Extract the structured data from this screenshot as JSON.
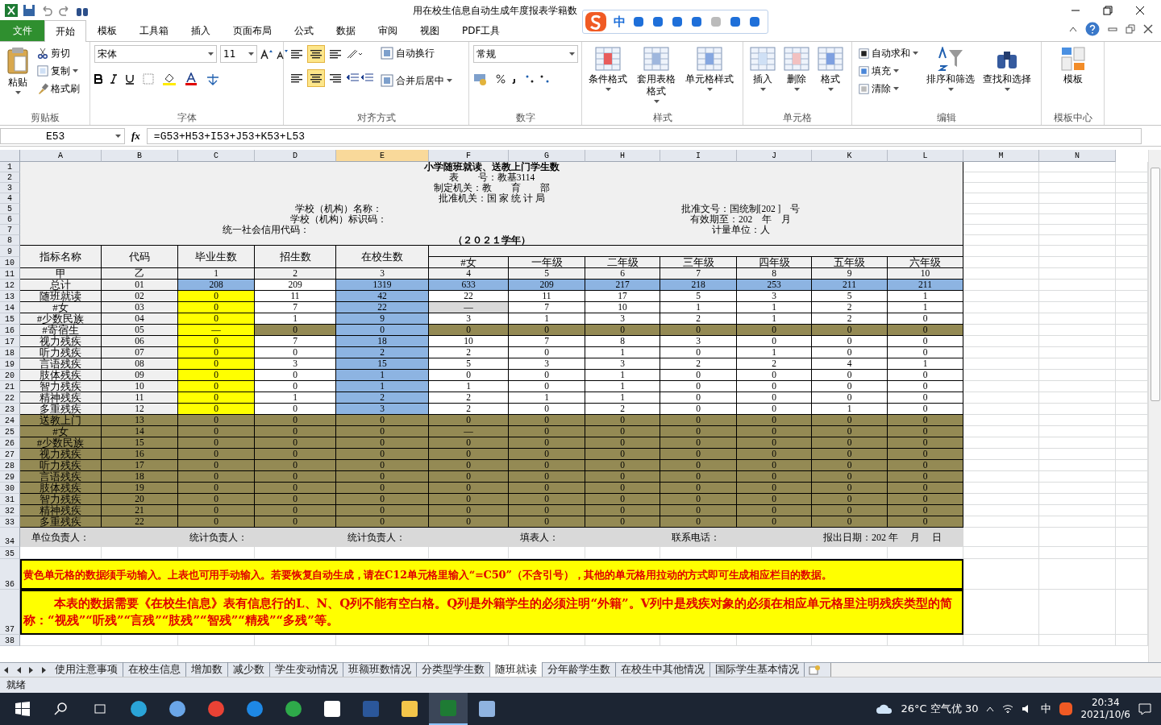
{
  "window": {
    "title": "用在校生信息自动生成年度报表学籍数"
  },
  "ime_toolbar": {
    "mode": "中"
  },
  "ribbon_tabs": [
    {
      "label": "文件",
      "kind": "file",
      "selected": false
    },
    {
      "label": "开始",
      "kind": "tab",
      "selected": true
    },
    {
      "label": "模板",
      "kind": "tab",
      "selected": false
    },
    {
      "label": "工具箱",
      "kind": "tab",
      "selected": false
    },
    {
      "label": "插入",
      "kind": "tab",
      "selected": false
    },
    {
      "label": "页面布局",
      "kind": "tab",
      "selected": false
    },
    {
      "label": "公式",
      "kind": "tab",
      "selected": false
    },
    {
      "label": "数据",
      "kind": "tab",
      "selected": false
    },
    {
      "label": "审阅",
      "kind": "tab",
      "selected": false
    },
    {
      "label": "视图",
      "kind": "tab",
      "selected": false
    },
    {
      "label": "PDF工具",
      "kind": "tab",
      "selected": false
    }
  ],
  "clipboard": {
    "paste": "粘贴",
    "cut": "剪切",
    "copy": "复制",
    "painter": "格式刷",
    "label": "剪贴板"
  },
  "font": {
    "name": "宋体",
    "size": "11",
    "label": "字体"
  },
  "alignment": {
    "vertical": [
      {
        "selected": false
      },
      {
        "selected": true
      },
      {
        "selected": false
      }
    ],
    "horizontal": [
      {
        "selected": false
      },
      {
        "selected": true
      },
      {
        "selected": false
      }
    ],
    "wrap": "自动换行",
    "merge": "合并后居中",
    "label": "对齐方式"
  },
  "number": {
    "format": "常规",
    "label": "数字"
  },
  "styles": {
    "items": [
      "条件格式",
      "套用表格格式",
      "单元格样式"
    ],
    "label": "样式"
  },
  "cells_group": {
    "items": [
      "插入",
      "删除",
      "格式"
    ],
    "label": "单元格"
  },
  "editing": {
    "small": [
      "自动求和",
      "填充",
      "清除"
    ],
    "big": [
      "排序和筛选",
      "查找和选择"
    ],
    "label": "编辑"
  },
  "template": {
    "item": "模板",
    "label": "模板中心"
  },
  "formula_bar": {
    "name_box": "E53",
    "fx_label": "fx",
    "formula": "=G53+H53+I53+J53+K53+L53"
  },
  "column_headers": [
    {
      "label": "A",
      "selected": false
    },
    {
      "label": "B",
      "selected": false
    },
    {
      "label": "C",
      "selected": false
    },
    {
      "label": "D",
      "selected": false
    },
    {
      "label": "E",
      "selected": true
    },
    {
      "label": "F",
      "selected": false
    },
    {
      "label": "G",
      "selected": false
    },
    {
      "label": "H",
      "selected": false
    },
    {
      "label": "I",
      "selected": false
    },
    {
      "label": "J",
      "selected": false
    },
    {
      "label": "K",
      "selected": false
    },
    {
      "label": "L",
      "selected": false
    },
    {
      "label": "M",
      "selected": false
    },
    {
      "label": "N",
      "selected": false
    }
  ],
  "row_numbers": [
    "1",
    "2",
    "3",
    "4",
    "5",
    "6",
    "7",
    "8",
    "9",
    "10",
    "11",
    "12",
    "13",
    "14",
    "15",
    "16",
    "17",
    "18",
    "19",
    "20",
    "21",
    "22",
    "23",
    "24",
    "25",
    "26",
    "27",
    "28",
    "29",
    "30",
    "31",
    "32",
    "33",
    "34",
    "35",
    "36",
    "37",
    "38"
  ],
  "report_header": {
    "title": "小学随班就读、送教上门学生数",
    "center_lines": [
      "表　　号：教基3114",
      "制定机关：教　　育　　部",
      "批准机关：国 家 统 计 局"
    ],
    "left_lines": [
      "学校（机构）名称：",
      "学校（机构）标识码：",
      "统一社会信用代码："
    ],
    "right_lines": [
      "批准文号：国统制[202 ]　号",
      "有效期至：202　年　月",
      "计量单位：人"
    ],
    "year": "（２０２１学年）"
  },
  "table": {
    "fixed_columns": [
      "指标名称",
      "代码",
      "毕业生数",
      "招生数",
      "在校生数"
    ],
    "grade_columns": [
      "#女",
      "一年级",
      "二年级",
      "三年级",
      "四年级",
      "五年级",
      "六年级"
    ],
    "rows": [
      {
        "cells": [
          {
            "text": "甲",
            "color": "#f0f0f0"
          },
          {
            "text": "乙",
            "color": "#f0f0f0"
          },
          {
            "text": "1",
            "color": "#f0f0f0"
          },
          {
            "text": "2",
            "color": "#f0f0f0"
          },
          {
            "text": "3",
            "color": "#f0f0f0"
          },
          {
            "text": "4",
            "color": "#f0f0f0"
          },
          {
            "text": "5",
            "color": "#f0f0f0"
          },
          {
            "text": "6",
            "color": "#f0f0f0"
          },
          {
            "text": "7",
            "color": "#f0f0f0"
          },
          {
            "text": "8",
            "color": "#f0f0f0"
          },
          {
            "text": "9",
            "color": "#f0f0f0"
          },
          {
            "text": "10",
            "color": "#f0f0f0"
          }
        ]
      },
      {
        "cells": [
          {
            "text": "总计",
            "color": "#f0f0f0"
          },
          {
            "text": "01",
            "color": "#f0f0f0"
          },
          {
            "text": "208",
            "color": "#8db4e2"
          },
          {
            "text": "209",
            "color": "#ffffff"
          },
          {
            "text": "1319",
            "color": "#8db4e2"
          },
          {
            "text": "633",
            "color": "#8db4e2"
          },
          {
            "text": "209",
            "color": "#8db4e2"
          },
          {
            "text": "217",
            "color": "#8db4e2"
          },
          {
            "text": "218",
            "color": "#8db4e2"
          },
          {
            "text": "253",
            "color": "#8db4e2"
          },
          {
            "text": "211",
            "color": "#8db4e2"
          },
          {
            "text": "211",
            "color": "#8db4e2"
          }
        ]
      },
      {
        "cells": [
          {
            "text": "随班就读",
            "color": "#f0f0f0"
          },
          {
            "text": "02",
            "color": "#f0f0f0"
          },
          {
            "text": "0",
            "color": "#ffff00"
          },
          {
            "text": "11",
            "color": "#ffffff"
          },
          {
            "text": "42",
            "color": "#8db4e2"
          },
          {
            "text": "22",
            "color": "#ffffff"
          },
          {
            "text": "11",
            "color": "#ffffff"
          },
          {
            "text": "17",
            "color": "#ffffff"
          },
          {
            "text": "5",
            "color": "#ffffff"
          },
          {
            "text": "3",
            "color": "#ffffff"
          },
          {
            "text": "5",
            "color": "#ffffff"
          },
          {
            "text": "1",
            "color": "#ffffff"
          }
        ]
      },
      {
        "cells": [
          {
            "text": "#女",
            "color": "#f0f0f0"
          },
          {
            "text": "03",
            "color": "#f0f0f0"
          },
          {
            "text": "0",
            "color": "#ffff00"
          },
          {
            "text": "7",
            "color": "#ffffff"
          },
          {
            "text": "22",
            "color": "#8db4e2"
          },
          {
            "text": "—",
            "color": "#d9d9d9"
          },
          {
            "text": "7",
            "color": "#ffffff"
          },
          {
            "text": "10",
            "color": "#ffffff"
          },
          {
            "text": "1",
            "color": "#ffffff"
          },
          {
            "text": "1",
            "color": "#ffffff"
          },
          {
            "text": "2",
            "color": "#ffffff"
          },
          {
            "text": "1",
            "color": "#ffffff"
          }
        ]
      },
      {
        "cells": [
          {
            "text": "#少数民族",
            "color": "#f0f0f0"
          },
          {
            "text": "04",
            "color": "#f0f0f0"
          },
          {
            "text": "0",
            "color": "#ffff00"
          },
          {
            "text": "1",
            "color": "#ffffff"
          },
          {
            "text": "9",
            "color": "#8db4e2"
          },
          {
            "text": "3",
            "color": "#ffffff"
          },
          {
            "text": "1",
            "color": "#ffffff"
          },
          {
            "text": "3",
            "color": "#ffffff"
          },
          {
            "text": "2",
            "color": "#ffffff"
          },
          {
            "text": "1",
            "color": "#ffffff"
          },
          {
            "text": "2",
            "color": "#ffffff"
          },
          {
            "text": "0",
            "color": "#ffffff"
          }
        ]
      },
      {
        "cells": [
          {
            "text": "#寄宿生",
            "color": "#f0f0f0"
          },
          {
            "text": "05",
            "color": "#f0f0f0"
          },
          {
            "text": "—",
            "color": "#ffff00"
          },
          {
            "text": "0",
            "color": "#948a54"
          },
          {
            "text": "0",
            "color": "#8db4e2"
          },
          {
            "text": "0",
            "color": "#948a54"
          },
          {
            "text": "0",
            "color": "#948a54"
          },
          {
            "text": "0",
            "color": "#948a54"
          },
          {
            "text": "0",
            "color": "#948a54"
          },
          {
            "text": "0",
            "color": "#948a54"
          },
          {
            "text": "0",
            "color": "#948a54"
          },
          {
            "text": "0",
            "color": "#948a54"
          }
        ]
      },
      {
        "cells": [
          {
            "text": "视力残疾",
            "color": "#f0f0f0"
          },
          {
            "text": "06",
            "color": "#f0f0f0"
          },
          {
            "text": "0",
            "color": "#ffff00"
          },
          {
            "text": "7",
            "color": "#ffffff"
          },
          {
            "text": "18",
            "color": "#8db4e2"
          },
          {
            "text": "10",
            "color": "#ffffff"
          },
          {
            "text": "7",
            "color": "#ffffff"
          },
          {
            "text": "8",
            "color": "#ffffff"
          },
          {
            "text": "3",
            "color": "#ffffff"
          },
          {
            "text": "0",
            "color": "#ffffff"
          },
          {
            "text": "0",
            "color": "#ffffff"
          },
          {
            "text": "0",
            "color": "#ffffff"
          }
        ]
      },
      {
        "cells": [
          {
            "text": "听力残疾",
            "color": "#f0f0f0"
          },
          {
            "text": "07",
            "color": "#f0f0f0"
          },
          {
            "text": "0",
            "color": "#ffff00"
          },
          {
            "text": "0",
            "color": "#ffffff"
          },
          {
            "text": "2",
            "color": "#8db4e2"
          },
          {
            "text": "2",
            "color": "#ffffff"
          },
          {
            "text": "0",
            "color": "#ffffff"
          },
          {
            "text": "1",
            "color": "#ffffff"
          },
          {
            "text": "0",
            "color": "#ffffff"
          },
          {
            "text": "1",
            "color": "#ffffff"
          },
          {
            "text": "0",
            "color": "#ffffff"
          },
          {
            "text": "0",
            "color": "#ffffff"
          }
        ]
      },
      {
        "cells": [
          {
            "text": "言语残疾",
            "color": "#f0f0f0"
          },
          {
            "text": "08",
            "color": "#f0f0f0"
          },
          {
            "text": "0",
            "color": "#ffff00"
          },
          {
            "text": "3",
            "color": "#ffffff"
          },
          {
            "text": "15",
            "color": "#8db4e2"
          },
          {
            "text": "5",
            "color": "#ffffff"
          },
          {
            "text": "3",
            "color": "#ffffff"
          },
          {
            "text": "3",
            "color": "#ffffff"
          },
          {
            "text": "2",
            "color": "#ffffff"
          },
          {
            "text": "2",
            "color": "#ffffff"
          },
          {
            "text": "4",
            "color": "#ffffff"
          },
          {
            "text": "1",
            "color": "#ffffff"
          }
        ]
      },
      {
        "cells": [
          {
            "text": "肢体残疾",
            "color": "#f0f0f0"
          },
          {
            "text": "09",
            "color": "#f0f0f0"
          },
          {
            "text": "0",
            "color": "#ffff00"
          },
          {
            "text": "0",
            "color": "#ffffff"
          },
          {
            "text": "1",
            "color": "#8db4e2"
          },
          {
            "text": "0",
            "color": "#ffffff"
          },
          {
            "text": "0",
            "color": "#ffffff"
          },
          {
            "text": "1",
            "color": "#ffffff"
          },
          {
            "text": "0",
            "color": "#ffffff"
          },
          {
            "text": "0",
            "color": "#ffffff"
          },
          {
            "text": "0",
            "color": "#ffffff"
          },
          {
            "text": "0",
            "color": "#ffffff"
          }
        ]
      },
      {
        "cells": [
          {
            "text": "智力残疾",
            "color": "#f0f0f0"
          },
          {
            "text": "10",
            "color": "#f0f0f0"
          },
          {
            "text": "0",
            "color": "#ffff00"
          },
          {
            "text": "0",
            "color": "#ffffff"
          },
          {
            "text": "1",
            "color": "#8db4e2"
          },
          {
            "text": "1",
            "color": "#ffffff"
          },
          {
            "text": "0",
            "color": "#ffffff"
          },
          {
            "text": "1",
            "color": "#ffffff"
          },
          {
            "text": "0",
            "color": "#ffffff"
          },
          {
            "text": "0",
            "color": "#ffffff"
          },
          {
            "text": "0",
            "color": "#ffffff"
          },
          {
            "text": "0",
            "color": "#ffffff"
          }
        ]
      },
      {
        "cells": [
          {
            "text": "精神残疾",
            "color": "#f0f0f0"
          },
          {
            "text": "11",
            "color": "#f0f0f0"
          },
          {
            "text": "0",
            "color": "#ffff00"
          },
          {
            "text": "1",
            "color": "#ffffff"
          },
          {
            "text": "2",
            "color": "#8db4e2"
          },
          {
            "text": "2",
            "color": "#ffffff"
          },
          {
            "text": "1",
            "color": "#ffffff"
          },
          {
            "text": "1",
            "color": "#ffffff"
          },
          {
            "text": "0",
            "color": "#ffffff"
          },
          {
            "text": "0",
            "color": "#ffffff"
          },
          {
            "text": "0",
            "color": "#ffffff"
          },
          {
            "text": "0",
            "color": "#ffffff"
          }
        ]
      },
      {
        "cells": [
          {
            "text": "多重残疾",
            "color": "#f0f0f0"
          },
          {
            "text": "12",
            "color": "#f0f0f0"
          },
          {
            "text": "0",
            "color": "#ffff00"
          },
          {
            "text": "0",
            "color": "#ffffff"
          },
          {
            "text": "3",
            "color": "#8db4e2"
          },
          {
            "text": "2",
            "color": "#ffffff"
          },
          {
            "text": "0",
            "color": "#ffffff"
          },
          {
            "text": "2",
            "color": "#ffffff"
          },
          {
            "text": "0",
            "color": "#ffffff"
          },
          {
            "text": "0",
            "color": "#ffffff"
          },
          {
            "text": "1",
            "color": "#ffffff"
          },
          {
            "text": "0",
            "color": "#ffffff"
          }
        ]
      },
      {
        "cells": [
          {
            "text": "送教上门",
            "color": "#948a54"
          },
          {
            "text": "13",
            "color": "#948a54"
          },
          {
            "text": "0",
            "color": "#948a54"
          },
          {
            "text": "0",
            "color": "#948a54"
          },
          {
            "text": "0",
            "color": "#948a54"
          },
          {
            "text": "0",
            "color": "#948a54"
          },
          {
            "text": "0",
            "color": "#948a54"
          },
          {
            "text": "0",
            "color": "#948a54"
          },
          {
            "text": "0",
            "color": "#948a54"
          },
          {
            "text": "0",
            "color": "#948a54"
          },
          {
            "text": "0",
            "color": "#948a54"
          },
          {
            "text": "0",
            "color": "#948a54"
          }
        ]
      },
      {
        "cells": [
          {
            "text": "#女",
            "color": "#948a54"
          },
          {
            "text": "14",
            "color": "#948a54"
          },
          {
            "text": "0",
            "color": "#948a54"
          },
          {
            "text": "0",
            "color": "#948a54"
          },
          {
            "text": "0",
            "color": "#948a54"
          },
          {
            "text": "—",
            "color": "#948a54"
          },
          {
            "text": "0",
            "color": "#948a54"
          },
          {
            "text": "0",
            "color": "#948a54"
          },
          {
            "text": "0",
            "color": "#948a54"
          },
          {
            "text": "0",
            "color": "#948a54"
          },
          {
            "text": "0",
            "color": "#948a54"
          },
          {
            "text": "0",
            "color": "#948a54"
          }
        ]
      },
      {
        "cells": [
          {
            "text": "#少数民族",
            "color": "#948a54"
          },
          {
            "text": "15",
            "color": "#948a54"
          },
          {
            "text": "0",
            "color": "#948a54"
          },
          {
            "text": "0",
            "color": "#948a54"
          },
          {
            "text": "0",
            "color": "#948a54"
          },
          {
            "text": "0",
            "color": "#948a54"
          },
          {
            "text": "0",
            "color": "#948a54"
          },
          {
            "text": "0",
            "color": "#948a54"
          },
          {
            "text": "0",
            "color": "#948a54"
          },
          {
            "text": "0",
            "color": "#948a54"
          },
          {
            "text": "0",
            "color": "#948a54"
          },
          {
            "text": "0",
            "color": "#948a54"
          }
        ]
      },
      {
        "cells": [
          {
            "text": "视力残疾",
            "color": "#948a54"
          },
          {
            "text": "16",
            "color": "#948a54"
          },
          {
            "text": "0",
            "color": "#948a54"
          },
          {
            "text": "0",
            "color": "#948a54"
          },
          {
            "text": "0",
            "color": "#948a54"
          },
          {
            "text": "0",
            "color": "#948a54"
          },
          {
            "text": "0",
            "color": "#948a54"
          },
          {
            "text": "0",
            "color": "#948a54"
          },
          {
            "text": "0",
            "color": "#948a54"
          },
          {
            "text": "0",
            "color": "#948a54"
          },
          {
            "text": "0",
            "color": "#948a54"
          },
          {
            "text": "0",
            "color": "#948a54"
          }
        ]
      },
      {
        "cells": [
          {
            "text": "听力残疾",
            "color": "#948a54"
          },
          {
            "text": "17",
            "color": "#948a54"
          },
          {
            "text": "0",
            "color": "#948a54"
          },
          {
            "text": "0",
            "color": "#948a54"
          },
          {
            "text": "0",
            "color": "#948a54"
          },
          {
            "text": "0",
            "color": "#948a54"
          },
          {
            "text": "0",
            "color": "#948a54"
          },
          {
            "text": "0",
            "color": "#948a54"
          },
          {
            "text": "0",
            "color": "#948a54"
          },
          {
            "text": "0",
            "color": "#948a54"
          },
          {
            "text": "0",
            "color": "#948a54"
          },
          {
            "text": "0",
            "color": "#948a54"
          }
        ]
      },
      {
        "cells": [
          {
            "text": "言语残疾",
            "color": "#948a54"
          },
          {
            "text": "18",
            "color": "#948a54"
          },
          {
            "text": "0",
            "color": "#948a54"
          },
          {
            "text": "0",
            "color": "#948a54"
          },
          {
            "text": "0",
            "color": "#948a54"
          },
          {
            "text": "0",
            "color": "#948a54"
          },
          {
            "text": "0",
            "color": "#948a54"
          },
          {
            "text": "0",
            "color": "#948a54"
          },
          {
            "text": "0",
            "color": "#948a54"
          },
          {
            "text": "0",
            "color": "#948a54"
          },
          {
            "text": "0",
            "color": "#948a54"
          },
          {
            "text": "0",
            "color": "#948a54"
          }
        ]
      },
      {
        "cells": [
          {
            "text": "肢体残疾",
            "color": "#948a54"
          },
          {
            "text": "19",
            "color": "#948a54"
          },
          {
            "text": "0",
            "color": "#948a54"
          },
          {
            "text": "0",
            "color": "#948a54"
          },
          {
            "text": "0",
            "color": "#948a54"
          },
          {
            "text": "0",
            "color": "#948a54"
          },
          {
            "text": "0",
            "color": "#948a54"
          },
          {
            "text": "0",
            "color": "#948a54"
          },
          {
            "text": "0",
            "color": "#948a54"
          },
          {
            "text": "0",
            "color": "#948a54"
          },
          {
            "text": "0",
            "color": "#948a54"
          },
          {
            "text": "0",
            "color": "#948a54"
          }
        ]
      },
      {
        "cells": [
          {
            "text": "智力残疾",
            "color": "#948a54"
          },
          {
            "text": "20",
            "color": "#948a54"
          },
          {
            "text": "0",
            "color": "#948a54"
          },
          {
            "text": "0",
            "color": "#948a54"
          },
          {
            "text": "0",
            "color": "#948a54"
          },
          {
            "text": "0",
            "color": "#948a54"
          },
          {
            "text": "0",
            "color": "#948a54"
          },
          {
            "text": "0",
            "color": "#948a54"
          },
          {
            "text": "0",
            "color": "#948a54"
          },
          {
            "text": "0",
            "color": "#948a54"
          },
          {
            "text": "0",
            "color": "#948a54"
          },
          {
            "text": "0",
            "color": "#948a54"
          }
        ]
      },
      {
        "cells": [
          {
            "text": "精神残疾",
            "color": "#948a54"
          },
          {
            "text": "21",
            "color": "#948a54"
          },
          {
            "text": "0",
            "color": "#948a54"
          },
          {
            "text": "0",
            "color": "#948a54"
          },
          {
            "text": "0",
            "color": "#948a54"
          },
          {
            "text": "0",
            "color": "#948a54"
          },
          {
            "text": "0",
            "color": "#948a54"
          },
          {
            "text": "0",
            "color": "#948a54"
          },
          {
            "text": "0",
            "color": "#948a54"
          },
          {
            "text": "0",
            "color": "#948a54"
          },
          {
            "text": "0",
            "color": "#948a54"
          },
          {
            "text": "0",
            "color": "#948a54"
          }
        ]
      },
      {
        "cells": [
          {
            "text": "多重残疾",
            "color": "#948a54"
          },
          {
            "text": "22",
            "color": "#948a54"
          },
          {
            "text": "0",
            "color": "#948a54"
          },
          {
            "text": "0",
            "color": "#948a54"
          },
          {
            "text": "0",
            "color": "#948a54"
          },
          {
            "text": "0",
            "color": "#948a54"
          },
          {
            "text": "0",
            "color": "#948a54"
          },
          {
            "text": "0",
            "color": "#948a54"
          },
          {
            "text": "0",
            "color": "#948a54"
          },
          {
            "text": "0",
            "color": "#948a54"
          },
          {
            "text": "0",
            "color": "#948a54"
          },
          {
            "text": "0",
            "color": "#948a54"
          }
        ]
      }
    ]
  },
  "signatures": [
    "单位负责人：",
    "统计负责人：",
    "统计负责人：",
    "填表人：",
    "联系电话：",
    "报出日期：202 年　 月　 日"
  ],
  "notes": [
    "黄色单元格的数据须手动输入。上表也可用手动输入。若要恢复自动生成，请在C12单元格里输入“=C50”（不含引号），其他的单元格用拉动的方式即可生成相应栏目的数据。",
    "本表的数据需要《在校生信息》表有信息行的L、N、Q列不能有空白格。Q列是外籍学生的必须注明“外籍”。V列中是残疾对象的必须在相应单元格里注明残疾类型的简称：“视残”“听残”“言残”“肢残”“智残”“精残”“多残”等。"
  ],
  "sheet_tabs": [
    {
      "label": "使用注意事项",
      "selected": false
    },
    {
      "label": "在校生信息",
      "selected": false
    },
    {
      "label": "增加数",
      "selected": false
    },
    {
      "label": "减少数",
      "selected": false
    },
    {
      "label": "学生变动情况",
      "selected": false
    },
    {
      "label": "班额班数情况",
      "selected": false
    },
    {
      "label": "分类型学生数",
      "selected": false
    },
    {
      "label": "随班就读",
      "selected": true
    },
    {
      "label": "分年龄学生数",
      "selected": false
    },
    {
      "label": "在校生中其他情况",
      "selected": false
    },
    {
      "label": "国际学生基本情况",
      "selected": false
    }
  ],
  "status_bar": {
    "text": "就绪"
  },
  "taskbar": {
    "weather": "26°C 空气优 30",
    "ime": "中",
    "time": "20:34",
    "date": "2021/10/6"
  }
}
